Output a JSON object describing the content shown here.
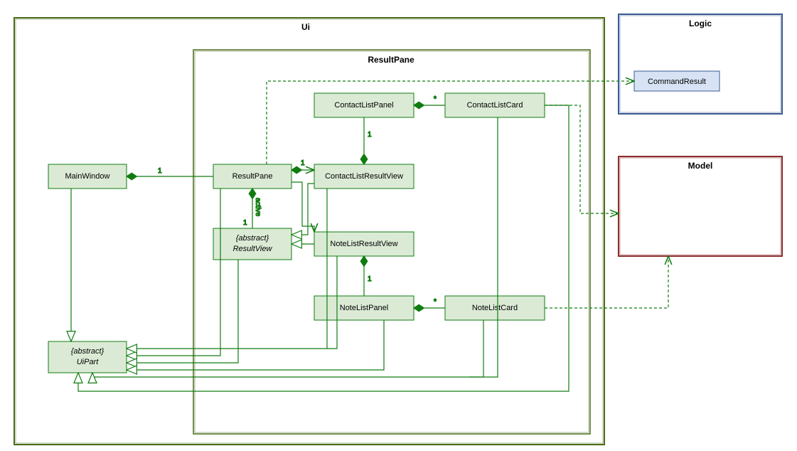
{
  "packages": {
    "ui": {
      "label": "Ui"
    },
    "resultPane": {
      "label": "ResultPane"
    },
    "logic": {
      "label": "Logic"
    },
    "model": {
      "label": "Model"
    }
  },
  "classes": {
    "mainWindow": {
      "name": "MainWindow"
    },
    "resultPane": {
      "name": "ResultPane"
    },
    "contactListResultView": {
      "name": "ContactListResultView"
    },
    "contactListPanel": {
      "name": "ContactListPanel"
    },
    "contactListCard": {
      "name": "ContactListCard"
    },
    "resultView": {
      "stereotype": "{abstract}",
      "name": "ResultView"
    },
    "noteListResultView": {
      "name": "NoteListResultView"
    },
    "noteListPanel": {
      "name": "NoteListPanel"
    },
    "noteListCard": {
      "name": "NoteListCard"
    },
    "uiPart": {
      "stereotype": "{abstract}",
      "name": "UiPart"
    },
    "commandResult": {
      "name": "CommandResult"
    }
  },
  "multiplicities": {
    "mw_rp": "1",
    "rp_clrv": "1",
    "clrv_clp": "1",
    "clp_clc": "*",
    "rp_rv_active": "active",
    "rp_rv": "1",
    "nlrv_nlp": "1",
    "nlp_nlc": "*"
  }
}
